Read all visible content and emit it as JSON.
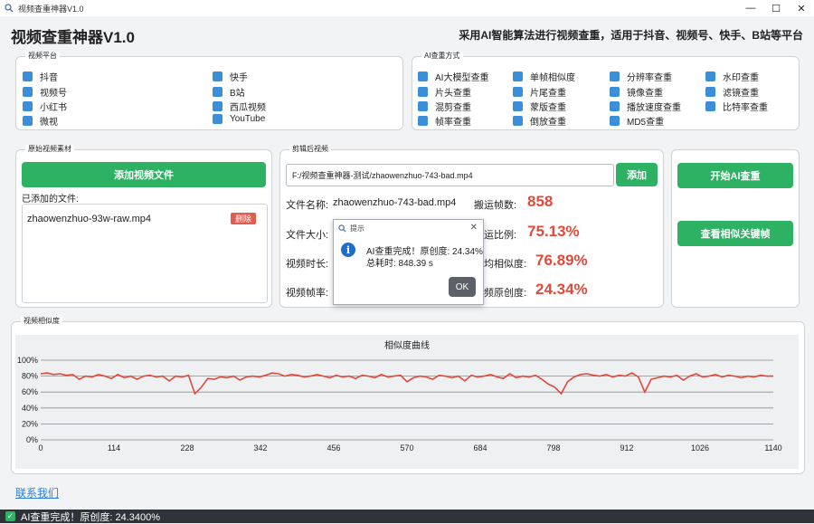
{
  "window": {
    "title": "视频查重神器V1.0",
    "controls": [
      "—",
      "☐",
      "✕"
    ]
  },
  "header": {
    "app_title": "视频查重神器V1.0",
    "subtitle": "采用AI智能算法进行视频查重，适用于抖音、视频号、快手、B站等平台"
  },
  "platform_group": {
    "label": "视频平台",
    "items": [
      "抖音",
      "快手",
      "视频号",
      "B站",
      "小红书",
      "西瓜视频",
      "微视",
      "YouTube"
    ]
  },
  "method_group": {
    "label": "AI查重方式",
    "items": [
      "AI大模型查重",
      "单帧相似度",
      "分辨率查重",
      "水印查重",
      "片头查重",
      "片尾查重",
      "镜像查重",
      "滤镜查重",
      "混剪查重",
      "蒙版查重",
      "播放速度查重",
      "比特率查重",
      "帧率查重",
      "倒放查重",
      "MD5查重"
    ]
  },
  "source_group": {
    "label": "原始视频素材",
    "add_button": "添加视频文件",
    "added_label": "已添加的文件:",
    "files": [
      {
        "name": "zhaowenzhuo-93w-raw.mp4",
        "delete_label": "删除"
      }
    ]
  },
  "edited_group": {
    "label": "剪辑后视频",
    "path_value": "F:/视频查重神器-测试/zhaowenzhuo-743-bad.mp4",
    "add_label": "添加",
    "file_name_label": "文件名称:",
    "file_name_value": "zhaowenzhuo-743-bad.mp4",
    "file_size_label": "文件大小:",
    "duration_label": "视频时长:",
    "fps_label": "视频帧率:",
    "stats": [
      {
        "label": "搬运帧数:",
        "value": "858"
      },
      {
        "label": "搬运比例:",
        "value": "75.13%"
      },
      {
        "label": "平均相似度:",
        "value": "76.89%"
      },
      {
        "label": "视频原创度:",
        "value": "24.34%"
      }
    ]
  },
  "actions": {
    "start": "开始AI查重",
    "view_keyframes": "查看相似关键帧"
  },
  "dialog": {
    "title": "提示",
    "line1": "AI查重完成！原创度: 24.34%",
    "line2": "总耗时: 848.39 s",
    "ok": "OK"
  },
  "similarity_group": {
    "label": "视频相似度"
  },
  "chart_data": {
    "type": "line",
    "title": "相似度曲线",
    "ylim": [
      0,
      100
    ],
    "y_ticks": [
      "100%",
      "80%",
      "60%",
      "40%",
      "20%",
      "0%"
    ],
    "xlim": [
      0,
      1140
    ],
    "x_ticks": [
      "0",
      "114",
      "228",
      "342",
      "456",
      "570",
      "684",
      "798",
      "912",
      "1026",
      "1140"
    ],
    "grid": true,
    "series": [
      {
        "color": "#e04a3b",
        "x": [
          0,
          10,
          20,
          30,
          40,
          50,
          60,
          70,
          80,
          90,
          100,
          110,
          120,
          130,
          140,
          150,
          160,
          170,
          180,
          190,
          200,
          210,
          220,
          230,
          240,
          250,
          260,
          270,
          280,
          290,
          300,
          310,
          320,
          330,
          340,
          350,
          360,
          370,
          380,
          390,
          400,
          410,
          420,
          430,
          440,
          450,
          460,
          470,
          480,
          490,
          500,
          510,
          520,
          530,
          540,
          550,
          560,
          570,
          580,
          590,
          600,
          610,
          620,
          630,
          640,
          650,
          660,
          670,
          680,
          690,
          700,
          710,
          720,
          730,
          740,
          750,
          760,
          770,
          780,
          790,
          800,
          810,
          820,
          830,
          840,
          850,
          860,
          870,
          880,
          890,
          900,
          910,
          920,
          930,
          940,
          950,
          960,
          970,
          980,
          990,
          1000,
          1010,
          1020,
          1030,
          1040,
          1050,
          1060,
          1070,
          1080,
          1090,
          1100,
          1110,
          1120,
          1130,
          1140
        ],
        "y": [
          83,
          84,
          82,
          83,
          81,
          82,
          76,
          80,
          79,
          82,
          80,
          77,
          82,
          78,
          80,
          76,
          80,
          81,
          79,
          80,
          74,
          80,
          79,
          81,
          58,
          66,
          77,
          76,
          79,
          78,
          80,
          75,
          79,
          80,
          79,
          81,
          84,
          83,
          80,
          82,
          81,
          79,
          80,
          82,
          80,
          78,
          81,
          79,
          80,
          77,
          81,
          80,
          78,
          82,
          79,
          80,
          81,
          73,
          78,
          80,
          79,
          76,
          81,
          80,
          78,
          80,
          74,
          81,
          79,
          80,
          82,
          79,
          77,
          83,
          78,
          80,
          79,
          81,
          76,
          70,
          66,
          58,
          73,
          79,
          82,
          83,
          81,
          80,
          82,
          79,
          81,
          80,
          84,
          79,
          60,
          76,
          78,
          80,
          79,
          81,
          75,
          80,
          83,
          79,
          80,
          82,
          79,
          81,
          80,
          78,
          80,
          79,
          81,
          80,
          80
        ]
      }
    ]
  },
  "footer": {
    "contact": "联系我们",
    "status": "AI查重完成！原创度: 24.3400%"
  }
}
